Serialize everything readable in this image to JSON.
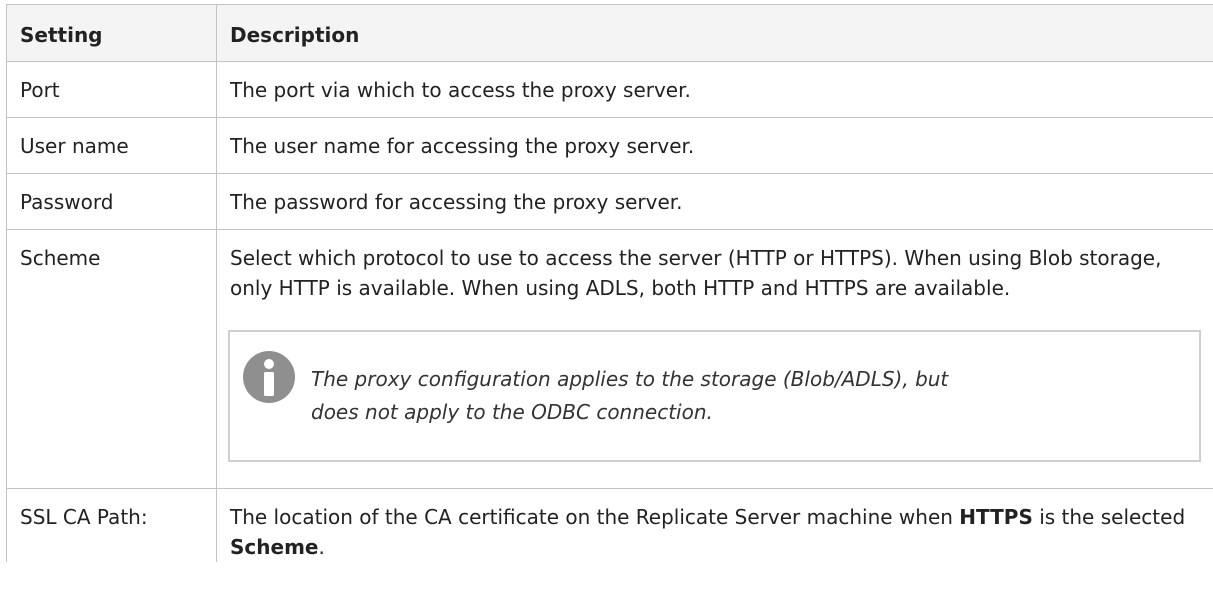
{
  "table": {
    "headers": [
      "Setting",
      "Description"
    ],
    "rows": [
      {
        "setting": "Port",
        "description": "The port via which to access the proxy server."
      },
      {
        "setting": "User name",
        "description": "The user name for accessing the proxy server."
      },
      {
        "setting": "Password",
        "description": "The password for accessing the proxy server."
      },
      {
        "setting": "Scheme",
        "description": "Select which protocol to use to access the server (HTTP or HTTPS). When using Blob storage, only HTTP is available. When using ADLS, both HTTP and HTTPS are available."
      }
    ],
    "note": {
      "icon": "info-icon",
      "icon_color": "#8f8f8f",
      "line1": "The proxy configuration applies to the storage (Blob/ADLS), but",
      "line2": "does not apply to the ODBC connection."
    },
    "last_row": {
      "setting": "SSL CA Path:",
      "desc_part1": "The location of the CA certificate on the Replicate Server machine when ",
      "desc_bold1": "HTTPS",
      "desc_part2": " is the selected ",
      "desc_bold2": "Scheme",
      "desc_part3": "."
    }
  }
}
